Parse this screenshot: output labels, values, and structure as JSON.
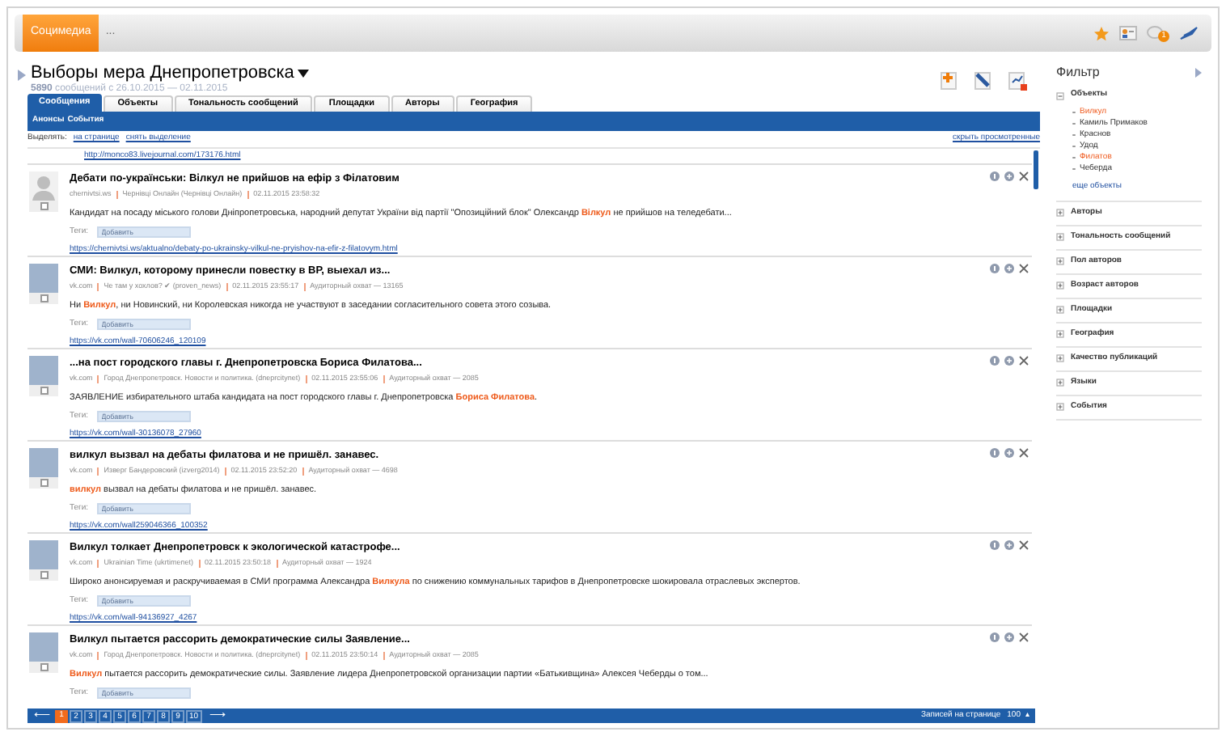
{
  "topbar": {
    "brand": "Социмедиа",
    "more": "...",
    "notification_count": "1"
  },
  "header": {
    "title": "Выборы мера Днепропетровска",
    "summary": "**5890** сообщений с 26.10.2015 — 02.11.2015"
  },
  "tabs": [
    {
      "label": "Сообщения",
      "selected": true
    },
    {
      "label": "Объекты",
      "selected": false
    },
    {
      "label": "Тональность сообщений",
      "selected": false
    },
    {
      "label": "Площадки",
      "selected": false
    },
    {
      "label": "Авторы",
      "selected": false
    },
    {
      "label": "География",
      "selected": false
    }
  ],
  "subtabs": [
    "Анонсы",
    "События"
  ],
  "selection_bar": {
    "label": "Выделять:",
    "links": [
      "на странице",
      "снять выделение"
    ],
    "hide_link": "скрыть просмотренные"
  },
  "previous_link": "http://monco83.livejournal.com/173176.html",
  "posts": [
    {
      "kind": "avatar",
      "checked": false,
      "title": "Дебати по-українськи: Вілкул не прийшов на ефір з Філатовим",
      "source": "chernivtsi.ws",
      "author": "Чернівці Онлайн (Чернівці Онлайн)",
      "date": "02.11.2015 23:58:32",
      "text": "Кандидат на посаду міського голови Дніпропетровська, народний депутат України від партії \"Опозиційний блок\" Олександр **Вілкул** не прийшов на теледебати...",
      "tags_label": "Теги:",
      "tags_placeholder": "Добавить",
      "url": "https://chernivtsi.ws/aktualno/debaty-po-ukrainsky-vilkul-ne-pryishov-na-efir-z-filatovym.html"
    },
    {
      "kind": "photo",
      "checked": false,
      "title": "СМИ: Вилкул, которому принесли повестку в ВР, выехал из...",
      "source": "vk.com",
      "author": "Че там у хохлов? ✔ (proven_news)",
      "date": "02.11.2015 23:55:17",
      "audience": "Аудиторный охват — 13165",
      "text": "Ни **Вилкул**, ни Новинский, ни Королевская никогда не участвуют в заседании согласительного совета этого созыва.",
      "tags_label": "Теги:",
      "tags_placeholder": "Добавить",
      "url": "https://vk.com/wall-70606246_120109"
    },
    {
      "kind": "photo",
      "checked": false,
      "title": "...на пост городского главы г. Днепропетровска Бориса Филатова...",
      "source": "vk.com",
      "author": "Город Днепропетровск. Новости и политика. (dneprcitynet)",
      "date": "02.11.2015 23:55:06",
      "audience": "Аудиторный охват — 2085",
      "text": "ЗАЯВЛЕНИЕ избирательного штаба кандидата на пост городского главы г. Днепропетровска **Бориса Филатова**.",
      "tags_label": "Теги:",
      "tags_placeholder": "Добавить",
      "url": "https://vk.com/wall-30136078_27960"
    },
    {
      "kind": "photo",
      "checked": false,
      "title": "вилкул вызвал на дебаты филатова и не пришёл. занавес.",
      "source": "vk.com",
      "author": "Изверг Бандеровский (izverg2014)",
      "date": "02.11.2015 23:52:20",
      "audience": "Аудиторный охват — 4698",
      "text": "**вилкул** вызвал на дебаты филатова и не пришёл. занавес.",
      "tags_label": "Теги:",
      "tags_placeholder": "Добавить",
      "url": "https://vk.com/wall259046366_100352"
    },
    {
      "kind": "photo",
      "checked": false,
      "title": "Вилкул толкает Днепропетровск к экологической катастрофе...",
      "source": "vk.com",
      "author": "Ukrainian Time (ukrtimenet)",
      "date": "02.11.2015 23:50:18",
      "audience": "Аудиторный охват — 1924",
      "text": "Широко анонсируемая и раскручиваемая в СМИ программа Александра **Вилкула** по снижению коммунальных тарифов в Днепропетровске шокировала отраслевых экспертов.",
      "tags_label": "Теги:",
      "tags_placeholder": "Добавить",
      "url": "https://vk.com/wall-94136927_4267"
    },
    {
      "kind": "photo",
      "checked": false,
      "title": "Вилкул пытается рассорить демократические силы Заявление...",
      "source": "vk.com",
      "author": "Город Днепропетровск. Новости и политика. (dneprcitynet)",
      "date": "02.11.2015 23:50:14",
      "audience": "Аудиторный охват — 2085",
      "text": "**Вилкул** пытается рассорить демократические силы. Заявление лидера Днепропетровской организации партии «Батькивщина» Алексея Чеберды о том...",
      "tags_label": "Теги:",
      "tags_placeholder": "Добавить"
    }
  ],
  "pagination": {
    "prev": "⟵",
    "pages": [
      {
        "label": "1",
        "selected": true
      },
      {
        "label": "2",
        "selected": false
      },
      {
        "label": "3",
        "selected": false
      },
      {
        "label": "4",
        "selected": false
      },
      {
        "label": "5",
        "selected": false
      },
      {
        "label": "6",
        "selected": false
      },
      {
        "label": "7",
        "selected": false
      },
      {
        "label": "8",
        "selected": false
      },
      {
        "label": "9",
        "selected": false
      },
      {
        "label": "10",
        "selected": false
      }
    ],
    "next": "⟶",
    "per_page_label": "Записей на странице",
    "per_page": "100",
    "per_page_caret": "▴"
  },
  "filter": {
    "title": "Фильтр",
    "sections": [
      {
        "label": "Объекты",
        "expanded": true,
        "items": [
          {
            "label": "Вилкул",
            "highlighted": true
          },
          {
            "label": "Камиль Примаков",
            "highlighted": false
          },
          {
            "label": "Краснов",
            "highlighted": false
          },
          {
            "label": "Удод",
            "highlighted": false
          },
          {
            "label": "Филатов",
            "highlighted": true
          },
          {
            "label": "Чеберда",
            "highlighted": false
          }
        ],
        "more": "еще объекты"
      },
      {
        "label": "Авторы",
        "expanded": false
      },
      {
        "label": "Тональность сообщений",
        "expanded": false
      },
      {
        "label": "Пол авторов",
        "expanded": false
      },
      {
        "label": "Возраст авторов",
        "expanded": false
      },
      {
        "label": "Площадки",
        "expanded": false
      },
      {
        "label": "География",
        "expanded": false
      },
      {
        "label": "Качество публикаций",
        "expanded": false
      },
      {
        "label": "Языки",
        "expanded": false
      },
      {
        "label": "События",
        "expanded": false
      }
    ]
  }
}
